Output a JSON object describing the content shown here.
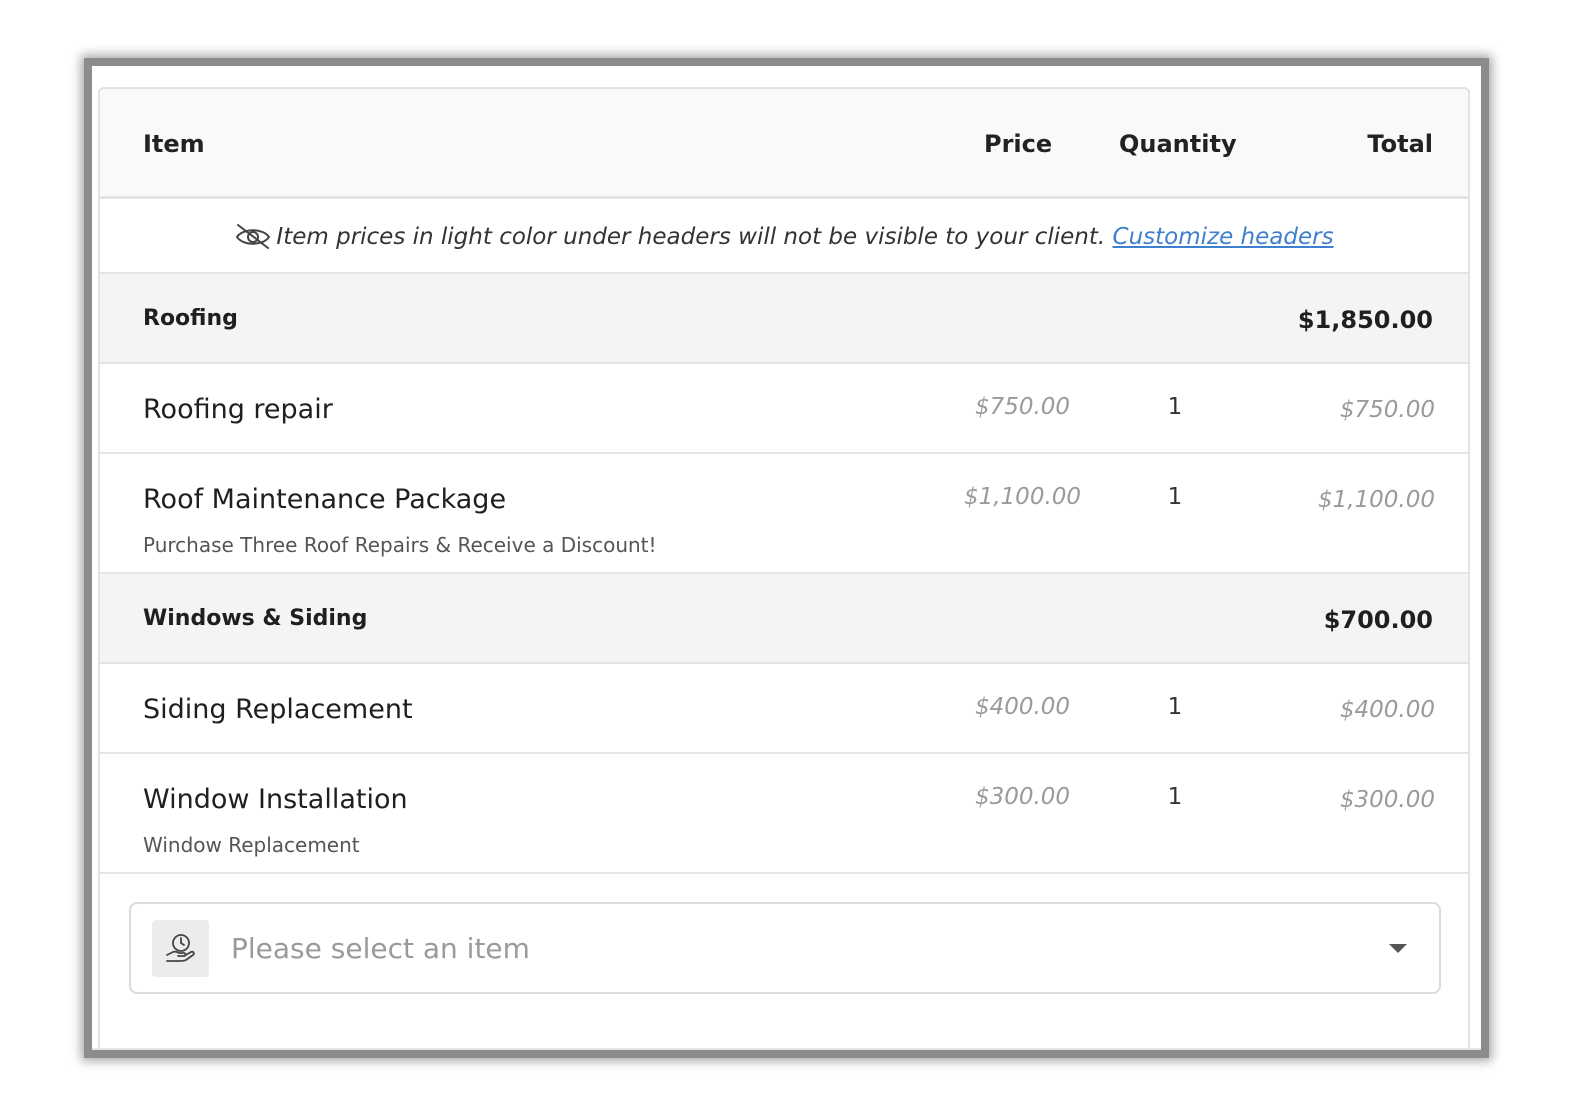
{
  "header": {
    "item": "Item",
    "price": "Price",
    "quantity": "Quantity",
    "total": "Total"
  },
  "notice": {
    "text": "Item prices in light color under headers will not be visible to your client.",
    "link": "Customize headers",
    "icon": "eye-slash-icon"
  },
  "groups": [
    {
      "name": "Roofing",
      "total": "$1,850.00",
      "items": [
        {
          "name": "Roofing repair",
          "description": "",
          "price": "$750.00",
          "quantity": "1",
          "total": "$750.00"
        },
        {
          "name": "Roof Maintenance Package",
          "description": "Purchase Three Roof Repairs & Receive a Discount!",
          "price": "$1,100.00",
          "quantity": "1",
          "total": "$1,100.00"
        }
      ]
    },
    {
      "name": "Windows & Siding",
      "total": "$700.00",
      "items": [
        {
          "name": "Siding Replacement",
          "description": "",
          "price": "$400.00",
          "quantity": "1",
          "total": "$400.00"
        },
        {
          "name": "Window Installation",
          "description": "Window Replacement",
          "price": "$300.00",
          "quantity": "1",
          "total": "$300.00"
        }
      ]
    }
  ],
  "item_select": {
    "placeholder": "Please select an item",
    "icon": "hand-dollar-icon"
  }
}
